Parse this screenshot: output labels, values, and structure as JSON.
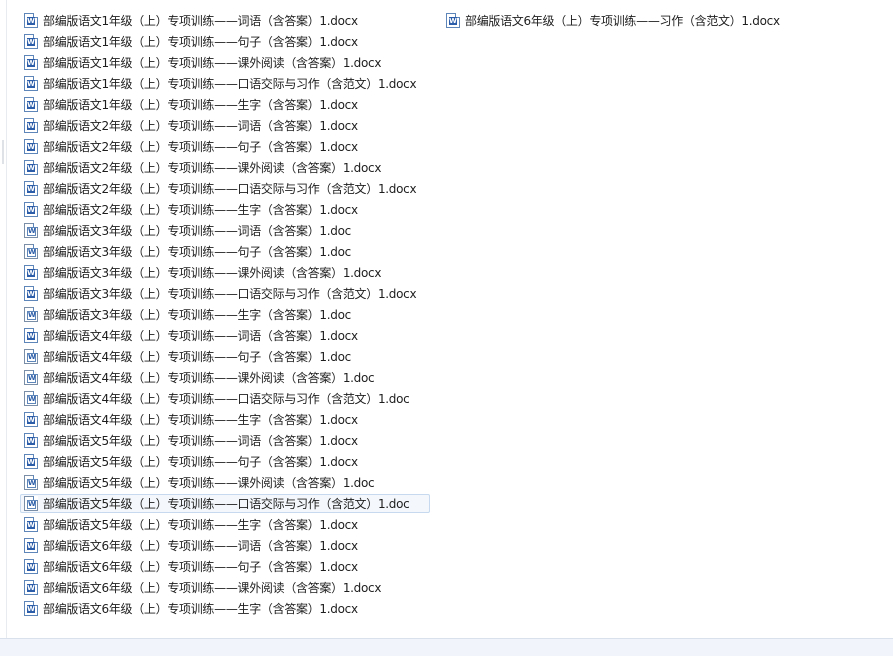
{
  "window": {
    "view": "list"
  },
  "files": {
    "column1": [
      {
        "name": "部编版语文1年级（上）专项训练——词语（含答案）1.docx",
        "type": "docx"
      },
      {
        "name": "部编版语文1年级（上）专项训练——句子（含答案）1.docx",
        "type": "docx"
      },
      {
        "name": "部编版语文1年级（上）专项训练——课外阅读（含答案）1.docx",
        "type": "docx"
      },
      {
        "name": "部编版语文1年级（上）专项训练——口语交际与习作（含范文）1.docx",
        "type": "docx"
      },
      {
        "name": "部编版语文1年级（上）专项训练——生字（含答案）1.docx",
        "type": "docx"
      },
      {
        "name": "部编版语文2年级（上）专项训练——词语（含答案）1.docx",
        "type": "docx"
      },
      {
        "name": "部编版语文2年级（上）专项训练——句子（含答案）1.docx",
        "type": "docx"
      },
      {
        "name": "部编版语文2年级（上）专项训练——课外阅读（含答案）1.docx",
        "type": "docx"
      },
      {
        "name": "部编版语文2年级（上）专项训练——口语交际与习作（含范文）1.docx",
        "type": "docx"
      },
      {
        "name": "部编版语文2年级（上）专项训练——生字（含答案）1.docx",
        "type": "docx"
      },
      {
        "name": "部编版语文3年级（上）专项训练——词语（含答案）1.doc",
        "type": "doc"
      },
      {
        "name": "部编版语文3年级（上）专项训练——句子（含答案）1.doc",
        "type": "doc"
      },
      {
        "name": "部编版语文3年级（上）专项训练——课外阅读（含答案）1.docx",
        "type": "docx"
      },
      {
        "name": "部编版语文3年级（上）专项训练——口语交际与习作（含范文）1.docx",
        "type": "docx"
      },
      {
        "name": "部编版语文3年级（上）专项训练——生字（含答案）1.doc",
        "type": "doc"
      },
      {
        "name": "部编版语文4年级（上）专项训练——词语（含答案）1.docx",
        "type": "docx"
      },
      {
        "name": "部编版语文4年级（上）专项训练——句子（含答案）1.doc",
        "type": "doc"
      },
      {
        "name": "部编版语文4年级（上）专项训练——课外阅读（含答案）1.doc",
        "type": "doc"
      },
      {
        "name": "部编版语文4年级（上）专项训练——口语交际与习作（含范文）1.doc",
        "type": "doc"
      },
      {
        "name": "部编版语文4年级（上）专项训练——生字（含答案）1.docx",
        "type": "docx"
      },
      {
        "name": "部编版语文5年级（上）专项训练——词语（含答案）1.docx",
        "type": "docx"
      },
      {
        "name": "部编版语文5年级（上）专项训练——句子（含答案）1.docx",
        "type": "docx"
      },
      {
        "name": "部编版语文5年级（上）专项训练——课外阅读（含答案）1.doc",
        "type": "doc"
      },
      {
        "name": "部编版语文5年级（上）专项训练——口语交际与习作（含范文）1.doc",
        "type": "doc",
        "focused": true
      },
      {
        "name": "部编版语文5年级（上）专项训练——生字（含答案）1.docx",
        "type": "docx"
      },
      {
        "name": "部编版语文6年级（上）专项训练——词语（含答案）1.docx",
        "type": "docx"
      },
      {
        "name": "部编版语文6年级（上）专项训练——句子（含答案）1.docx",
        "type": "docx"
      },
      {
        "name": "部编版语文6年级（上）专项训练——课外阅读（含答案）1.docx",
        "type": "docx"
      },
      {
        "name": "部编版语文6年级（上）专项训练——生字（含答案）1.docx",
        "type": "docx"
      }
    ],
    "column2": [
      {
        "name": "部编版语文6年级（上）专项训练——习作（含范文）1.docx",
        "type": "docx"
      }
    ]
  },
  "icons": {
    "docx": "word-docx-icon",
    "doc": "word-doc-icon"
  },
  "colors": {
    "focus_border": "#c6d9ee",
    "focus_fill": "#f4f8fc",
    "word_blue": "#2b5da8"
  }
}
